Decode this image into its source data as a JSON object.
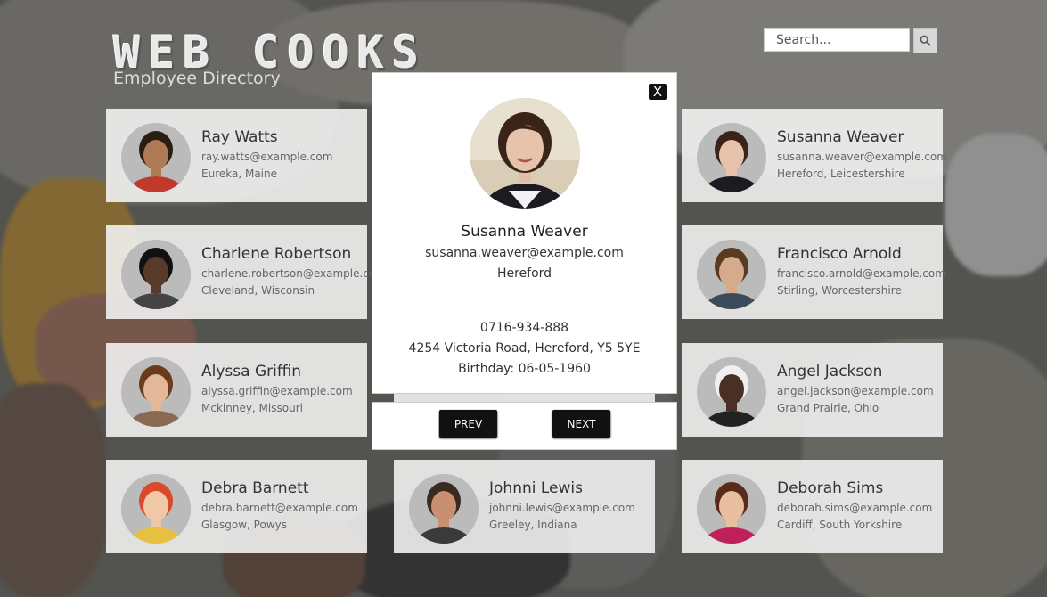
{
  "header": {
    "title": "WEB COOKS",
    "subtitle": "Employee Directory"
  },
  "search": {
    "placeholder": "Search...",
    "button_icon": "search-icon"
  },
  "employees": [
    {
      "name": "Ray Watts",
      "email": "ray.watts@example.com",
      "location": "Eureka, Maine",
      "skin": "#b07a55",
      "hair": "#2a1d14",
      "shirt": "#c0392b"
    },
    {
      "name": "Susanna Weaver",
      "email": "susanna.weaver@example.com",
      "location": "Hereford, Leicestershire",
      "skin": "#e6c3aa",
      "hair": "#3a2318",
      "shirt": "#1b1b22"
    },
    {
      "name": "Charlene Robertson",
      "email": "charlene.robertson@example.com",
      "location": "Cleveland, Wisconsin",
      "skin": "#5a3a28",
      "hair": "#111111",
      "shirt": "#444444"
    },
    {
      "name": "Francisco Arnold",
      "email": "francisco.arnold@example.com",
      "location": "Stirling, Worcestershire",
      "skin": "#d4ab8c",
      "hair": "#5a3b22",
      "shirt": "#3b4a5a"
    },
    {
      "name": "Alyssa Griffin",
      "email": "alyssa.griffin@example.com",
      "location": "Mckinney, Missouri",
      "skin": "#e2b898",
      "hair": "#6b3a1c",
      "shirt": "#8a6a55"
    },
    {
      "name": "Angel Jackson",
      "email": "angel.jackson@example.com",
      "location": "Grand Prairie, Ohio",
      "skin": "#4a3024",
      "hair": "#f0f0f0",
      "shirt": "#222222"
    },
    {
      "name": "Debra Barnett",
      "email": "debra.barnett@example.com",
      "location": "Glasgow, Powys",
      "skin": "#f0c8a8",
      "hair": "#d84a2a",
      "shirt": "#e8c040"
    },
    {
      "name": "Johnni Lewis",
      "email": "johnni.lewis@example.com",
      "location": "Greeley, Indiana",
      "skin": "#c89070",
      "hair": "#3a2a20",
      "shirt": "#3a3a3a"
    },
    {
      "name": "Deborah Sims",
      "email": "deborah.sims@example.com",
      "location": "Cardiff, South Yorkshire",
      "skin": "#e8c0a0",
      "hair": "#5a2a1a",
      "shirt": "#c0205a"
    }
  ],
  "modal": {
    "close_label": "X",
    "name": "Susanna Weaver",
    "email": "susanna.weaver@example.com",
    "city": "Hereford",
    "phone": "0716-934-888",
    "address": "4254 Victoria Road, Hereford, Y5 5YE",
    "birthday": "Birthday: 06-05-1960",
    "prev_label": "PREV",
    "next_label": "NEXT"
  }
}
